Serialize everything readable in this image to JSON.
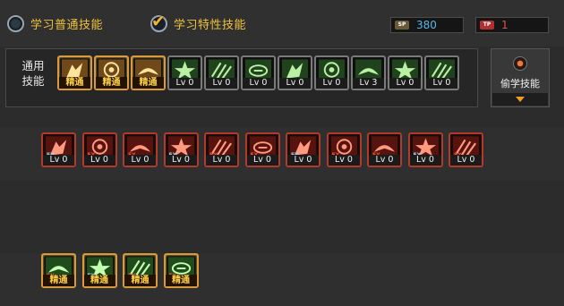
{
  "tabs": {
    "normal": {
      "label": "学习普通技能"
    },
    "special": {
      "label": "学习特性技能"
    }
  },
  "currency": {
    "sp": {
      "tag": "SP",
      "value": "380",
      "color": "#5ab8e8"
    },
    "tp": {
      "tag": "TP",
      "value": "1",
      "color": "#e05050"
    }
  },
  "common": {
    "title_line1": "通用",
    "title_line2": "技能",
    "skills": [
      {
        "icon": "seated-figure-icon",
        "label": "精通",
        "frame": "gold"
      },
      {
        "icon": "crouch-figure-icon",
        "label": "精通",
        "frame": "gold"
      },
      {
        "icon": "leap-figure-icon",
        "label": "精通",
        "frame": "gold"
      },
      {
        "icon": "winged-emblem-icon",
        "label": "Lv 0",
        "frame": "gray"
      },
      {
        "icon": "target-ring-icon",
        "label": "Lv 0",
        "frame": "gray"
      },
      {
        "icon": "crosshair-icon",
        "label": "Lv 0",
        "frame": "gray"
      },
      {
        "icon": "sprint-figure-icon",
        "label": "Lv 0",
        "frame": "gray"
      },
      {
        "icon": "swing-figure-icon",
        "label": "Lv 0",
        "frame": "gray"
      },
      {
        "icon": "spiral-icon",
        "label": "Lv 3",
        "frame": "gray"
      },
      {
        "icon": "raise-arms-icon",
        "label": "Lv 0",
        "frame": "gray"
      },
      {
        "icon": "blade-figure-icon",
        "label": "Lv 0",
        "frame": "gray"
      }
    ]
  },
  "steal": {
    "label": "偷学技能",
    "icon": "steal-orb-icon",
    "arrow": "dropdown-arrow-icon"
  },
  "ex_skills": [
    {
      "icon": "flame-slash-icon",
      "label": "Lv 0"
    },
    {
      "icon": "dash-strike-icon",
      "label": "Lv 0"
    },
    {
      "icon": "swift-kick-icon",
      "label": "Lv 0"
    },
    {
      "icon": "burst-spikes-icon",
      "label": "Lv 0"
    },
    {
      "icon": "whirl-icon",
      "label": "Lv 0"
    },
    {
      "icon": "rising-blade-icon",
      "label": "Lv 0"
    },
    {
      "icon": "charge-figure-icon",
      "label": "Lv 0"
    },
    {
      "icon": "cross-shot-icon",
      "label": "Lv 0"
    },
    {
      "icon": "dragon-head-icon",
      "label": "Lv 0"
    },
    {
      "icon": "bow-shot-icon",
      "label": "Lv 0"
    },
    {
      "icon": "spin-blade-icon",
      "label": "Lv 0"
    }
  ],
  "mastered": [
    {
      "icon": "green-vortex-icon",
      "label": "精通"
    },
    {
      "icon": "green-star-icon",
      "label": "精通"
    },
    {
      "icon": "green-spikes-icon",
      "label": "精通"
    },
    {
      "icon": "green-claw-icon",
      "label": "精通"
    }
  ],
  "ex_tag": "EX"
}
